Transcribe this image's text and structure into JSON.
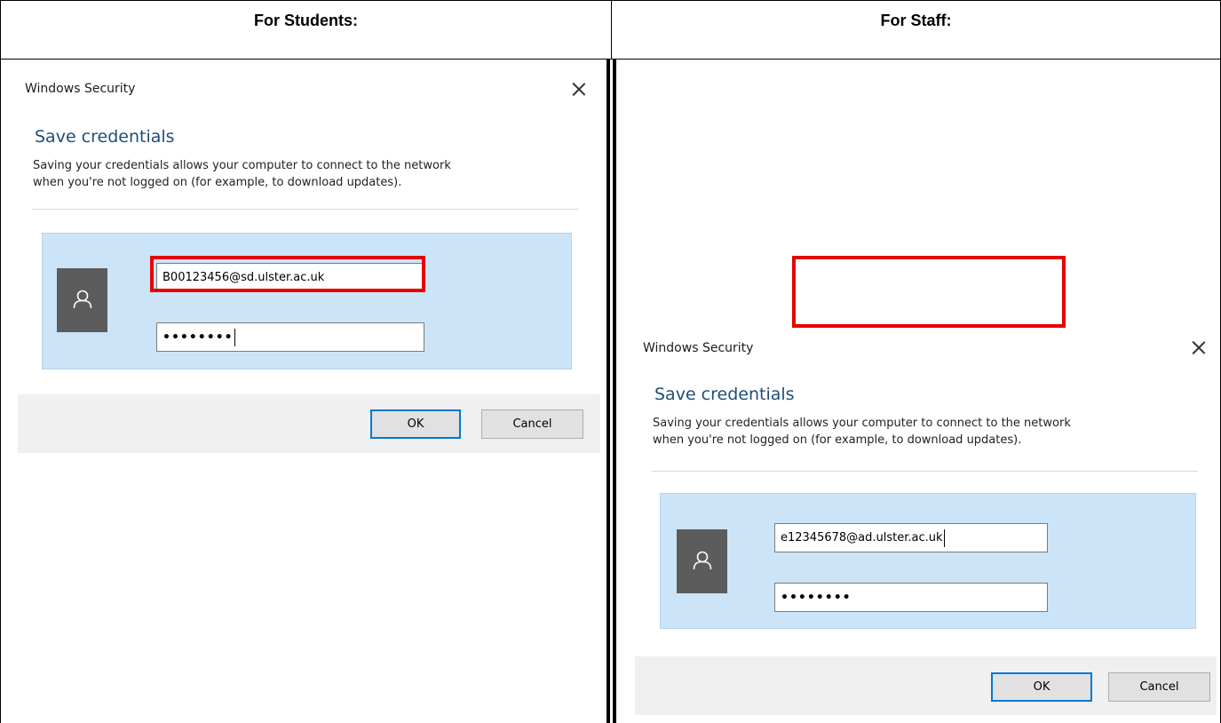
{
  "columns": {
    "students_heading": "For Students:",
    "staff_heading": "For Staff:"
  },
  "student_dialog": {
    "window_title": "Windows Security",
    "close_icon": "close-icon",
    "heading": "Save credentials",
    "description_line1": "Saving your credentials allows your computer to connect to the network",
    "description_line2": "when you're not logged on (for example, to download updates).",
    "avatar_icon": "user-icon",
    "username_value": "B00123456@sd.ulster.ac.uk",
    "password_value": "••••••••",
    "ok_label": "OK",
    "cancel_label": "Cancel"
  },
  "staff_dialog": {
    "window_title": "Windows Security",
    "close_icon": "close-icon",
    "heading": "Save credentials",
    "description_line1": "Saving your credentials allows your computer to connect to the network",
    "description_line2": "when you're not logged on (for example, to download updates).",
    "avatar_icon": "user-icon",
    "username_value": "e12345678@ad.ulster.ac.uk",
    "password_value": "••••••••",
    "ok_label": "OK",
    "cancel_label": "Cancel"
  },
  "colors": {
    "highlight": "#e60000",
    "panel": "#cce4f7",
    "heading": "#1f4e79",
    "ok_border": "#0078d7"
  }
}
